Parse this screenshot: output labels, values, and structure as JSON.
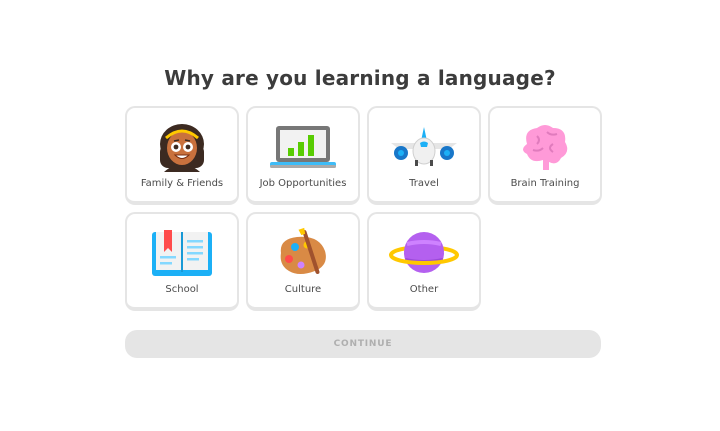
{
  "title": "Why are you learning a language?",
  "options": [
    {
      "label": "Family & Friends",
      "icon": "family-friends-icon"
    },
    {
      "label": "Job Opportunities",
      "icon": "laptop-chart-icon"
    },
    {
      "label": "Travel",
      "icon": "airplane-icon"
    },
    {
      "label": "Brain Training",
      "icon": "brain-icon"
    },
    {
      "label": "School",
      "icon": "book-icon"
    },
    {
      "label": "Culture",
      "icon": "paint-palette-icon"
    },
    {
      "label": "Other",
      "icon": "planet-icon"
    }
  ],
  "continue_label": "CONTINUE",
  "colors": {
    "border": "#e5e5e5",
    "button_disabled_bg": "#e5e5e5",
    "button_disabled_text": "#afafaf",
    "text": "#4b4b4b"
  }
}
